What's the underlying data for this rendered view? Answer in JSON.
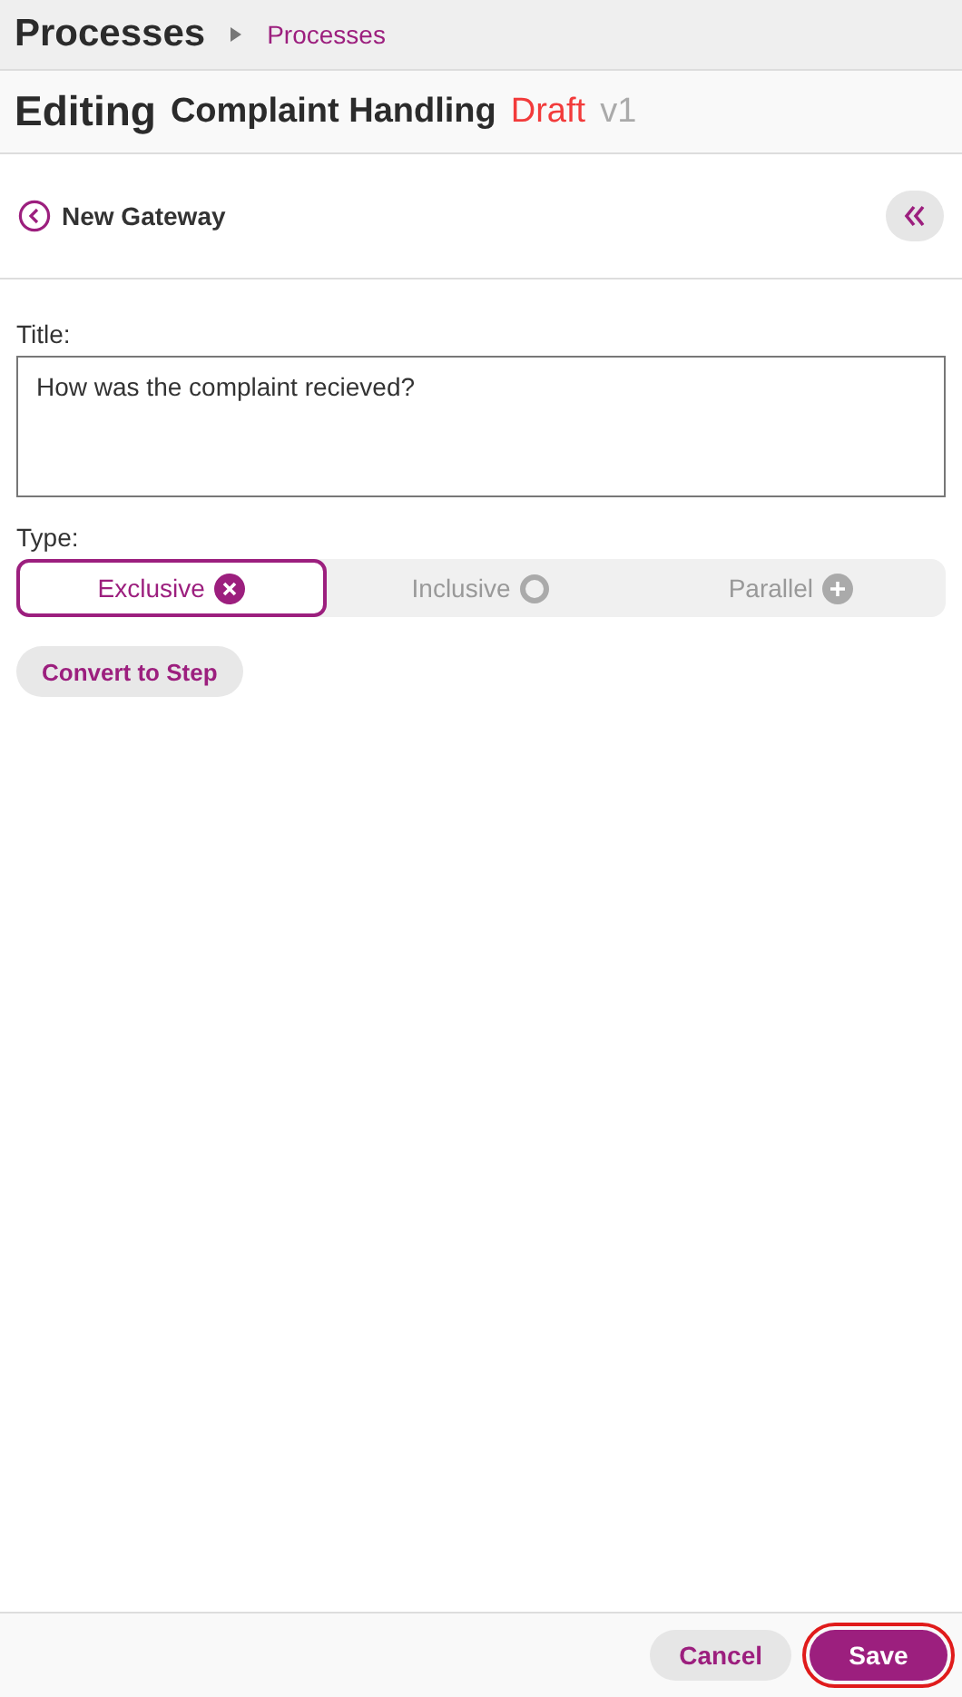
{
  "header": {
    "title": "Processes",
    "breadcrumb": "Processes"
  },
  "editing": {
    "label": "Editing",
    "name": "Complaint Handling",
    "status": "Draft",
    "version": "v1"
  },
  "panel": {
    "title": "New Gateway"
  },
  "form": {
    "title_label": "Title:",
    "title_value": "How was the complaint recieved?",
    "type_label": "Type:",
    "types": [
      {
        "label": "Exclusive",
        "kind": "exclusive",
        "selected": true
      },
      {
        "label": "Inclusive",
        "kind": "inclusive",
        "selected": false
      },
      {
        "label": "Parallel",
        "kind": "parallel",
        "selected": false
      }
    ],
    "convert_button": "Convert to Step"
  },
  "footer": {
    "buttons": [
      {
        "label": "Cancel",
        "kind": "secondary",
        "highlighted": false
      },
      {
        "label": "Save",
        "kind": "primary",
        "highlighted": true
      }
    ]
  }
}
